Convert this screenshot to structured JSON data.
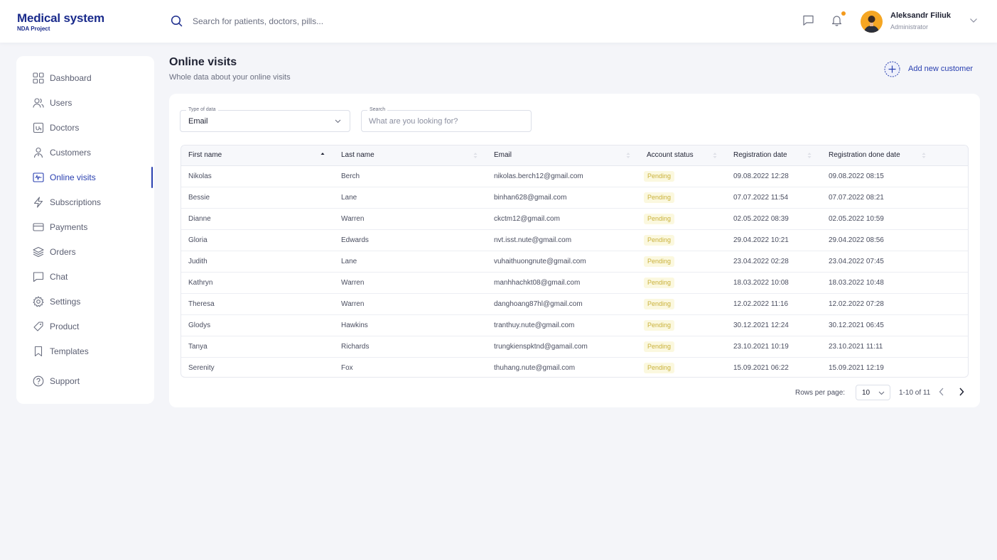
{
  "brand": {
    "title": "Medical system",
    "subtitle": "NDA Project",
    "color": "#1a2b8c"
  },
  "search": {
    "placeholder": "Search for patients, doctors, pills..."
  },
  "header": {
    "icons": [
      "message-icon",
      "bell-icon"
    ],
    "user": {
      "name": "Aleksandr Filiuk",
      "role": "Administrator"
    }
  },
  "sidebar": {
    "items": [
      {
        "label": "Dashboard",
        "icon": "dashboard-icon"
      },
      {
        "label": "Users",
        "icon": "users-icon"
      },
      {
        "label": "Doctors",
        "icon": "doctors-icon"
      },
      {
        "label": "Customers",
        "icon": "customers-icon"
      },
      {
        "label": "Online visits",
        "icon": "online-visits-icon",
        "active": true
      },
      {
        "label": "Subscriptions",
        "icon": "lightning-icon"
      },
      {
        "label": "Payments",
        "icon": "card-icon"
      },
      {
        "label": "Orders",
        "icon": "layers-icon"
      },
      {
        "label": "Chat",
        "icon": "chat-icon"
      },
      {
        "label": "Settings",
        "icon": "gear-icon"
      },
      {
        "label": "Product",
        "icon": "tag-icon"
      },
      {
        "label": "Templates",
        "icon": "bookmark-icon"
      }
    ],
    "support": {
      "label": "Support",
      "icon": "question-icon"
    }
  },
  "page": {
    "title": "Online visits",
    "subtitle": "Whole data about your online visits",
    "add_label": "Add new customer"
  },
  "filters": {
    "type_label": "Type of data",
    "type_value": "Email",
    "search_label": "Search",
    "search_placeholder": "What are you looking for?"
  },
  "table": {
    "columns": [
      "First name",
      "Last name",
      "Email",
      "Account status",
      "Registration date",
      "Registration done date"
    ],
    "rows": [
      {
        "first": "Nikolas",
        "last": "Berch",
        "email": "nikolas.berch12@gmail.com",
        "status": "Pending",
        "reg": "09.08.2022 12:28",
        "done": "09.08.2022 08:15"
      },
      {
        "first": "Bessie",
        "last": "Lane",
        "email": "binhan628@gmail.com",
        "status": "Pending",
        "reg": "07.07.2022 11:54",
        "done": "07.07.2022 08:21"
      },
      {
        "first": "Dianne",
        "last": "Warren",
        "email": "ckctm12@gmail.com",
        "status": "Pending",
        "reg": "02.05.2022 08:39",
        "done": "02.05.2022 10:59"
      },
      {
        "first": "Gloria",
        "last": "Edwards",
        "email": "nvt.isst.nute@gmail.com",
        "status": "Pending",
        "reg": "29.04.2022 10:21",
        "done": "29.04.2022 08:56"
      },
      {
        "first": "Judith",
        "last": "Lane",
        "email": "vuhaithuongnute@gmail.com",
        "status": "Pending",
        "reg": "23.04.2022 02:28",
        "done": "23.04.2022 07:45"
      },
      {
        "first": "Kathryn",
        "last": "Warren",
        "email": "manhhachkt08@gmail.com",
        "status": "Pending",
        "reg": "18.03.2022 10:08",
        "done": "18.03.2022 10:48"
      },
      {
        "first": "Theresa",
        "last": "Warren",
        "email": "danghoang87hl@gmail.com",
        "status": "Pending",
        "reg": "12.02.2022 11:16",
        "done": "12.02.2022 07:28"
      },
      {
        "first": "Glodys",
        "last": "Hawkins",
        "email": "tranthuy.nute@gmail.com",
        "status": "Pending",
        "reg": "30.12.2021 12:24",
        "done": "30.12.2021 06:45"
      },
      {
        "first": "Tanya",
        "last": "Richards",
        "email": "trungkienspktnd@gamail.com",
        "status": "Pending",
        "reg": "23.10.2021 10:19",
        "done": "23.10.2021 11:11"
      },
      {
        "first": "Serenity",
        "last": "Fox",
        "email": "thuhang.nute@gmail.com",
        "status": "Pending",
        "reg": "15.09.2021 06:22",
        "done": "15.09.2021 12:19"
      }
    ]
  },
  "pagination": {
    "rows_label": "Rows per page:",
    "rows_value": "10",
    "range": "1-10 of 11"
  },
  "colors": {
    "accent": "#2a40b0",
    "pending_bg": "#fbf8df",
    "pending_text": "#c9b13a",
    "notification_dot": "#f39a1d"
  }
}
